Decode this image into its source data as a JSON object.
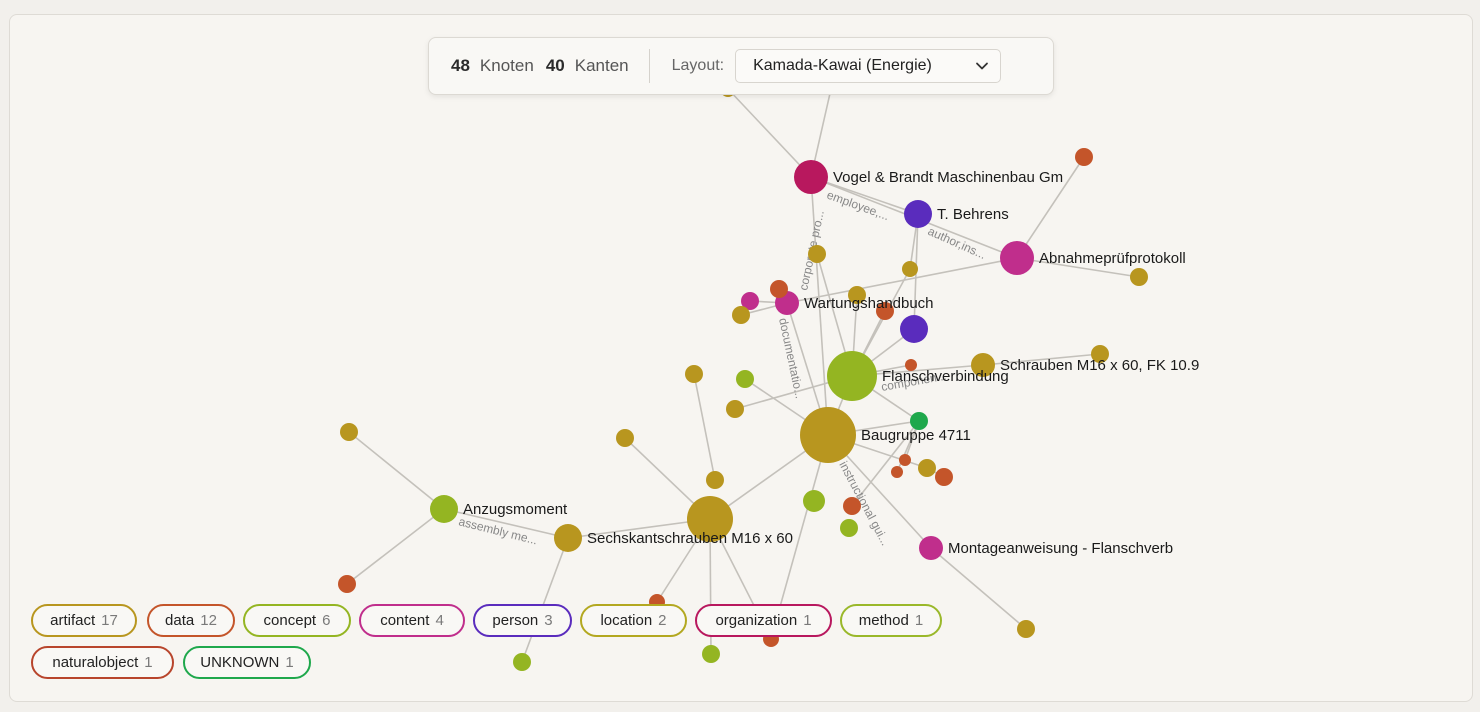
{
  "toolbar": {
    "node_count": "48",
    "node_word": "Knoten",
    "edge_count": "40",
    "edge_word": "Kanten",
    "layout_label": "Layout:",
    "layout_value": "Kamada-Kawai (Energie)"
  },
  "colors": {
    "artifact": "#b8961f",
    "data": "#c4552a",
    "concept": "#94b522",
    "content": "#c02e8c",
    "person": "#5a2cbd",
    "location": "#b3a820",
    "organization": "#b8185e",
    "method": "#9ab82a",
    "naturalobject": "#b8452c",
    "unknown": "#1fa84c"
  },
  "legend": [
    {
      "type": "artifact",
      "label": "artifact",
      "count": "17"
    },
    {
      "type": "data",
      "label": "data",
      "count": "12"
    },
    {
      "type": "concept",
      "label": "concept",
      "count": "6"
    },
    {
      "type": "content",
      "label": "content",
      "count": "4"
    },
    {
      "type": "person",
      "label": "person",
      "count": "3"
    },
    {
      "type": "location",
      "label": "location",
      "count": "2"
    },
    {
      "type": "organization",
      "label": "organization",
      "count": "1"
    },
    {
      "type": "method",
      "label": "method",
      "count": "1"
    },
    {
      "type": "naturalobject",
      "label": "naturalobject",
      "count": "1"
    },
    {
      "type": "unknown",
      "label": "UNKNOWN",
      "count": "1"
    }
  ],
  "labels": {
    "vogel": "Vogel & Brandt Maschinenbau Gm",
    "behrens": "T. Behrens",
    "abnahme": "Abnahmeprüfprotokoll",
    "wartung": "Wartungshandbuch",
    "flansch": "Flanschverbindung",
    "schrauben": "Schrauben M16 x 60, FK 10.9",
    "baugruppe": "Baugruppe 4711",
    "anzug": "Anzugsmoment",
    "sechskant": "Sechskantschrauben M16 x 60",
    "montage": "Montageanweisung - Flanschverb"
  },
  "edge_labels": {
    "employee": "employee,...",
    "author": "author,ins...",
    "corporate": "corporate pro...",
    "documentation": "documentatio...",
    "component": "componen...",
    "instructional": "instructional gui...",
    "assembly": "assembly me..."
  }
}
